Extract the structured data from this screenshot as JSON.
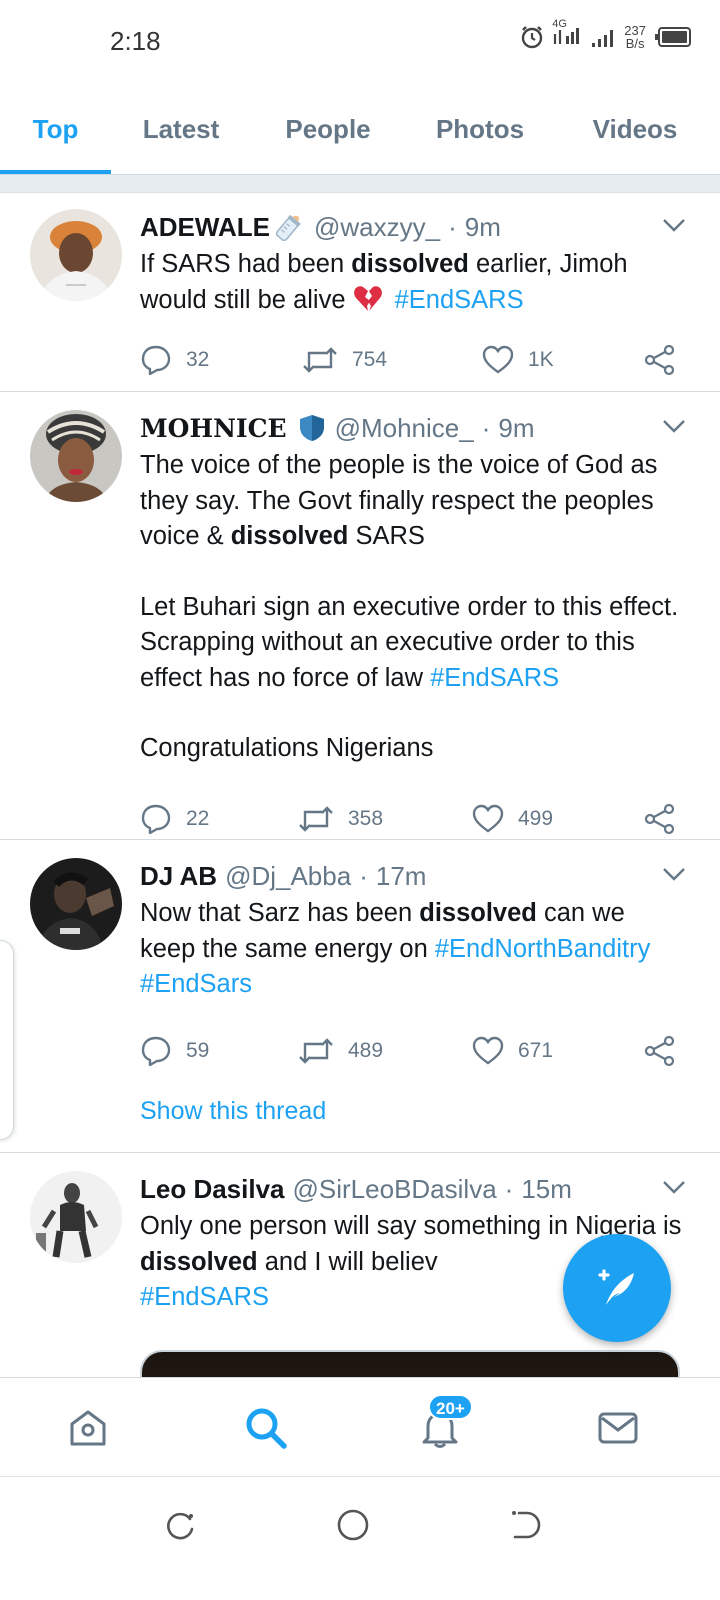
{
  "status_bar": {
    "time": "2:18",
    "network_label": "4G",
    "speed_value": "237",
    "speed_unit": "B/s"
  },
  "tabs": [
    {
      "label": "Top",
      "active": true
    },
    {
      "label": "Latest",
      "active": false
    },
    {
      "label": "People",
      "active": false
    },
    {
      "label": "Photos",
      "active": false
    },
    {
      "label": "Videos",
      "active": false
    }
  ],
  "tweets": [
    {
      "name": "ADEWALE",
      "name_emoji": "baby-bottle-icon",
      "handle": "@waxzyy_",
      "separator": "·",
      "time": "9m",
      "text_parts": [
        "If SARS had been ",
        "dissolved",
        " earlier, Jimoh would still be alive ",
        "#EndSARS"
      ],
      "emoji": "broken-heart-icon",
      "replies": "32",
      "retweets": "754",
      "likes": "1K"
    },
    {
      "name": "MOHNICE",
      "name_emoji": "blue-shield-icon",
      "handle": "@Mohnice_",
      "separator": "·",
      "time": "9m",
      "text_parts": [
        "The voice of the people is the voice of God as they say. The Govt finally respect the peoples voice & ",
        "dissolved",
        " SARS"
      ],
      "text_para2": "Let Buhari sign an executive order to this effect. Scrapping without an executive order to this effect has no force of law ",
      "text_para2_tag": "#EndSARS",
      "text_para3": "Congratulations Nigerians",
      "replies": "22",
      "retweets": "358",
      "likes": "499"
    },
    {
      "name": "DJ AB",
      "handle": "@Dj_Abba",
      "separator": "·",
      "time": "17m",
      "text_parts": [
        "Now that Sarz has been ",
        "dissolved",
        " can we keep the same energy on ",
        "#EndNorthBanditry",
        " ",
        "#EndSars"
      ],
      "replies": "59",
      "retweets": "489",
      "likes": "671",
      "show_thread": "Show this thread"
    },
    {
      "name": "Leo Dasilva",
      "handle": "@SirLeoBDasilva",
      "separator": "·",
      "time": "15m",
      "text_parts": [
        "Only one person will say something in Nigeria is ",
        "dissolved",
        " and I will believ",
        "#EndSARS"
      ]
    }
  ],
  "bottom_nav": {
    "items": [
      "home-icon",
      "search-icon",
      "notifications-icon",
      "messages-icon"
    ],
    "badge": "20+"
  },
  "colors": {
    "accent": "#1da1f2",
    "text": "#14171a",
    "muted": "#657786"
  }
}
